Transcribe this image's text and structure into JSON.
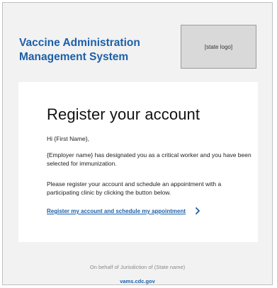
{
  "header": {
    "title_line1": "Vaccine Administration",
    "title_line2": "Management System",
    "logo_placeholder": "[state logo]"
  },
  "card": {
    "heading": "Register your account",
    "greeting": "Hi {First Name},",
    "paragraph1": "{Employer name} has designated you as a critical worker and you have been selected for immunization.",
    "paragraph2": "Please register your account and schedule an appointment with a participating clinic by clicking the button below.",
    "link_label": "Register my account and schedule my appointment",
    "link_icon": "chevron-right-icon"
  },
  "footer": {
    "on_behalf": "On behalf of Jurisdiction of (State name)",
    "url": "vams.cdc.gov"
  },
  "colors": {
    "brand_blue": "#1d5fa8",
    "background_gray": "#f2f2f2",
    "logo_box_gray": "#d9d9d9"
  }
}
